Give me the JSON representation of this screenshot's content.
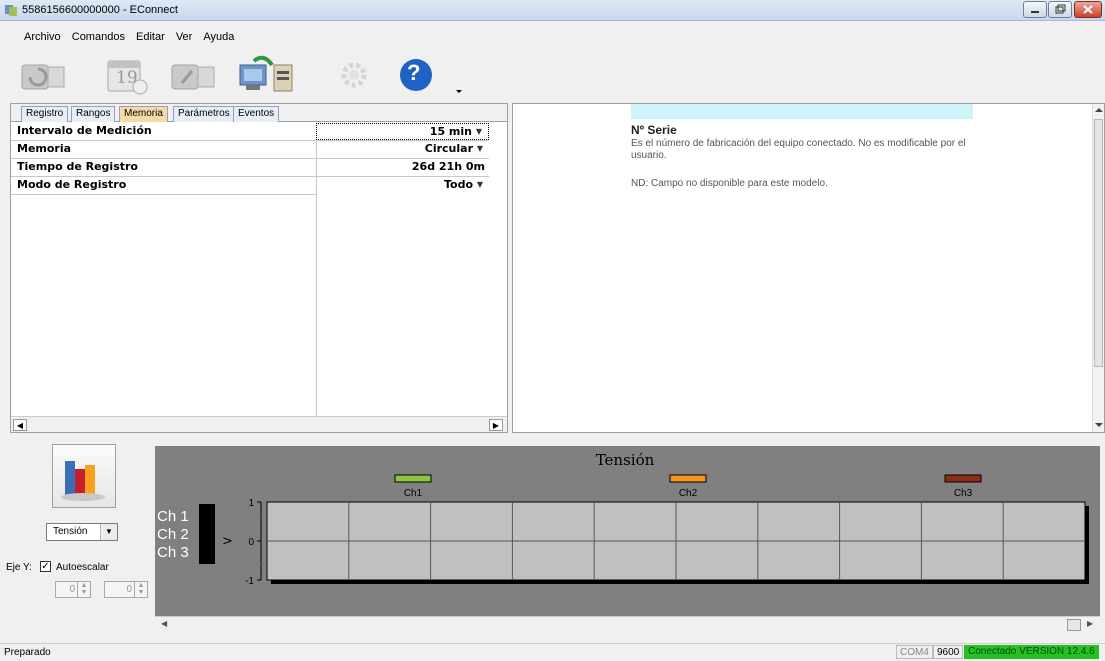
{
  "window": {
    "title": "5586156600000000 - EConnect"
  },
  "menu": [
    "Archivo",
    "Comandos",
    "Editar",
    "Ver",
    "Ayuda"
  ],
  "toolbar": {
    "icons": [
      "read-device-icon",
      "calendar-icon",
      "write-device-icon",
      "download-icon",
      "settings-icon",
      "help-icon"
    ],
    "calendar_day": "19",
    "help_glyph": "?"
  },
  "tabs": [
    "Registro",
    "Rangos",
    "Memoria",
    "Parámetros",
    "Eventos"
  ],
  "active_tab": "Memoria",
  "properties": [
    {
      "label": "Intervalo de Medición",
      "value": "15 min",
      "dropdown": true
    },
    {
      "label": "Memoria",
      "value": "Circular",
      "dropdown": true
    },
    {
      "label": "Tiempo de Registro",
      "value": "26d 21h 0m",
      "dropdown": false
    },
    {
      "label": "Modo de Registro",
      "value": "Todo",
      "dropdown": true
    }
  ],
  "help": {
    "heading": "Nº Serie",
    "text": "Es el número de fabricación del equipo conectado. No es modificable por el usuario.",
    "note": "ND: Campo no disponible para este modelo."
  },
  "bottom": {
    "select_value": "Tensión",
    "eje_label": "Eje Y:",
    "autoscale_label": "Autoescalar",
    "autoscale_checked": true,
    "spin1": "0",
    "spin2": "0"
  },
  "chart_data": {
    "type": "line",
    "title": "Tensión",
    "series": [
      {
        "name": "Ch1",
        "color": "#8cc63f",
        "values": []
      },
      {
        "name": "Ch2",
        "color": "#f7941d",
        "values": []
      },
      {
        "name": "Ch3",
        "color": "#8b2e14",
        "values": []
      }
    ],
    "ylim": [
      -1,
      1
    ],
    "yticks": [
      "1",
      "0",
      "-1"
    ],
    "channel_labels": [
      "Ch 1",
      "Ch 2",
      "Ch 3"
    ],
    "arrow": ">",
    "grid": true
  },
  "status": {
    "left": "Preparado",
    "port": "COM4",
    "baud": "9600",
    "connection": "Conectado VERSION 12.4.6",
    "connection_color": "#22c322"
  }
}
